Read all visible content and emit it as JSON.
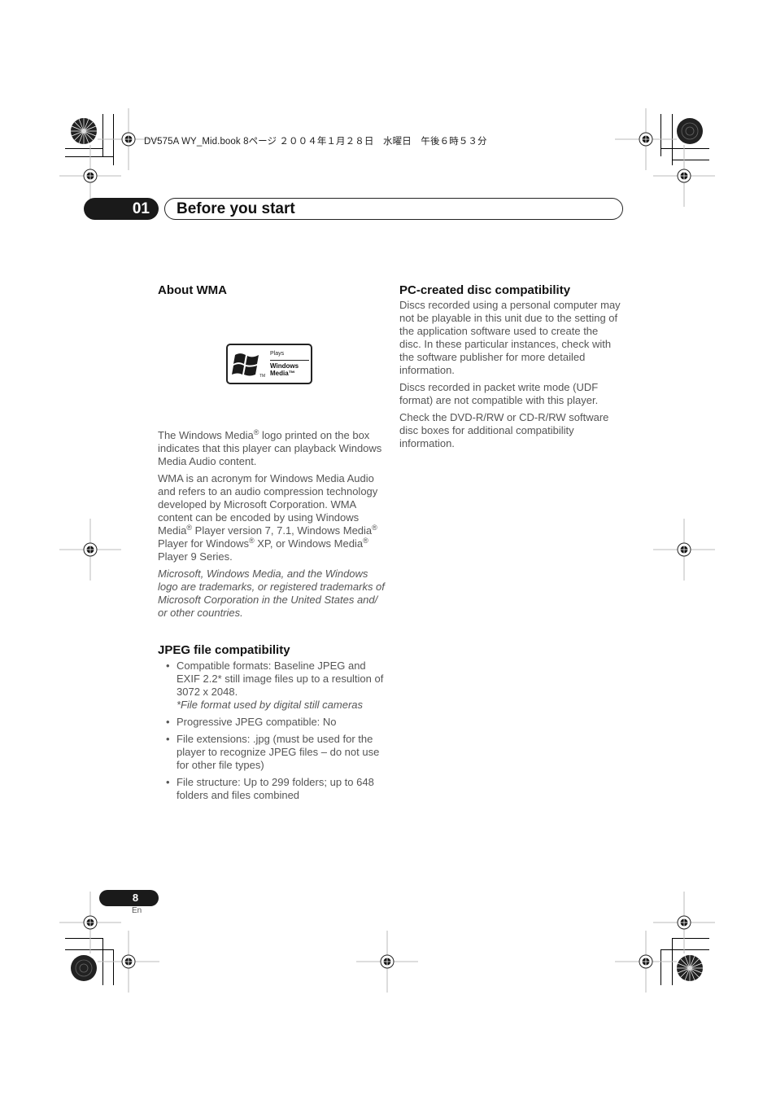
{
  "header": {
    "file_line": "DV575A WY_Mid.book  8ページ  ２００４年１月２８日　水曜日　午後６時５３分"
  },
  "chapter": {
    "number": "01",
    "title": "Before you start"
  },
  "about_wma": {
    "heading": "About WMA",
    "logo": {
      "icon": "windows-flag-icon",
      "plays": "Plays",
      "line1": "Windows",
      "line2": "Media™",
      "tm": "TM"
    },
    "p1": {
      "a": "The Windows Media",
      "b": " logo printed on the box indicates that this player can playback Windows Media Audio content."
    },
    "p2": {
      "a": "WMA is an acronym for Windows Media Audio and refers to an audio compression technology developed by Microsoft Corporation. WMA content can be encoded by using Windows Media",
      "b": " Player version 7, 7.1, Windows Media",
      "c": " Player for Windows",
      "d": " XP, or Windows Media",
      "e": " Player 9 Series."
    },
    "reg_mark": "®",
    "trademark_note": "Microsoft, Windows Media, and the Windows logo are trademarks, or registered trademarks of Microsoft Corporation in the United States and/ or other countries."
  },
  "jpeg": {
    "heading": "JPEG file compatibility",
    "bullets": [
      {
        "text": "Compatible formats: Baseline JPEG and EXIF 2.2* still image files up to a resultion of 3072 x 2048.",
        "note": "*File format used by digital still cameras"
      },
      {
        "text": "Progressive JPEG compatible: No"
      },
      {
        "text": "File extensions: .jpg (must be used for the player to recognize JPEG files – do not use for other file types)"
      },
      {
        "text": "File structure: Up to 299 folders; up to 648 folders and files combined"
      }
    ]
  },
  "pc_disc": {
    "heading": "PC-created disc compatibility",
    "paragraphs": [
      "Discs recorded using a personal computer may not be playable in this unit due to the setting of the application software used to create the disc. In these particular instances, check with the software publisher for more detailed information.",
      "Discs recorded in packet write mode (UDF format) are not compatible with this player.",
      "Check the DVD-R/RW or CD-R/RW software disc boxes for additional compatibility information."
    ]
  },
  "footer": {
    "page_number": "8",
    "language": "En"
  }
}
